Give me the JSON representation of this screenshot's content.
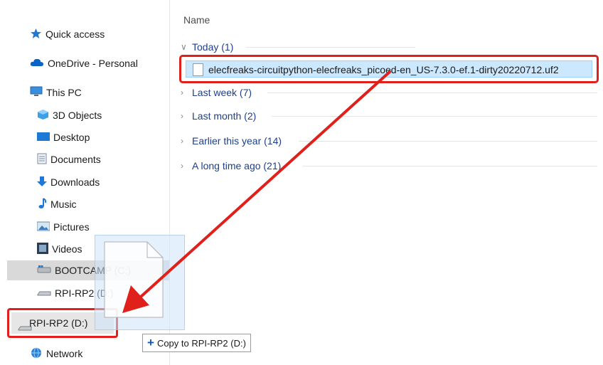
{
  "sidebar": {
    "quick_access": "Quick access",
    "onedrive": "OneDrive - Personal",
    "this_pc": "This PC",
    "objects3d": "3D Objects",
    "desktop": "Desktop",
    "documents": "Documents",
    "downloads": "Downloads",
    "music": "Music",
    "pictures": "Pictures",
    "videos": "Videos",
    "bootcamp": "BOOTCAMP (C:)",
    "rpi_rp2_a": "RPI-RP2 (D:)",
    "rpi_rp2_b": "RPI-RP2 (D:)",
    "network": "Network"
  },
  "content": {
    "column_name": "Name",
    "groups": {
      "today": "Today (1)",
      "last_week": "Last week (7)",
      "last_month": "Last month (2)",
      "earlier_year": "Earlier this year (14)",
      "long_ago": "A long time ago (21)"
    },
    "file_name": "elecfreaks-circuitpython-elecfreaks_picoed-en_US-7.3.0-ef.1-dirty20220712.uf2"
  },
  "drag": {
    "tooltip": "Copy to RPI-RP2 (D:)"
  },
  "colors": {
    "annotation": "#e0201b",
    "selection": "#cce8ff",
    "group_text": "#1e3f8a"
  }
}
